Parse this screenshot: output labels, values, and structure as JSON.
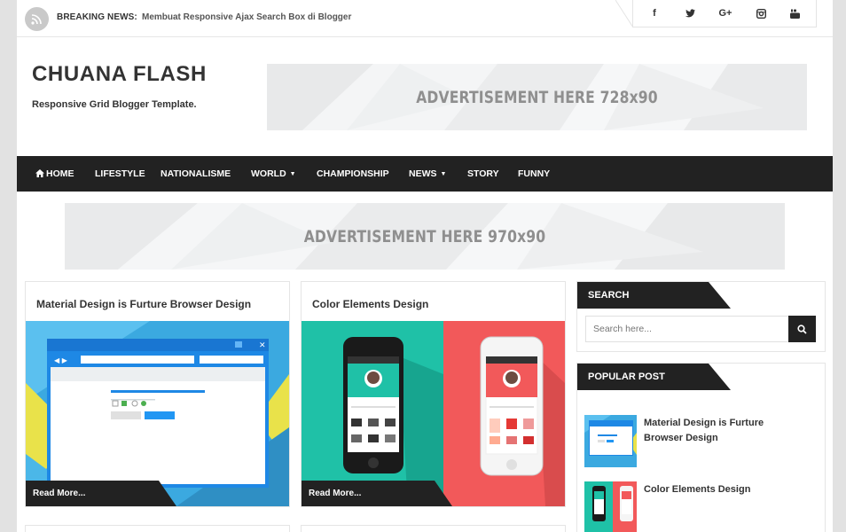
{
  "topbar": {
    "breaking_label": "BREAKING NEWS:",
    "breaking_text": "Membuat Responsive Ajax Search Box di Blogger",
    "rss_icon": "rss-icon",
    "social_icons": [
      "facebook-icon",
      "twitter-icon",
      "google-plus-icon",
      "instagram-icon",
      "youtube-icon"
    ]
  },
  "header": {
    "title": "CHUANA FLASH",
    "tagline": "Responsive Grid Blogger Template.",
    "ad_top": "ADVERTISEMENT HERE 728x90"
  },
  "nav": {
    "items": [
      {
        "label": "HOME",
        "icon": "home-icon"
      },
      {
        "label": "LIFESTYLE"
      },
      {
        "label": "NATIONALISME"
      },
      {
        "label": "WORLD",
        "dropdown": true
      },
      {
        "label": "CHAMPIONSHIP"
      },
      {
        "label": "NEWS",
        "dropdown": true
      },
      {
        "label": "STORY"
      },
      {
        "label": "FUNNY"
      }
    ]
  },
  "banner": {
    "ad_text": "ADVERTISEMENT HERE 970x90"
  },
  "posts": [
    {
      "title": "Material Design is Furture Browser Design",
      "read_more": "Read More..."
    },
    {
      "title": "Color Elements Design",
      "read_more": "Read More..."
    }
  ],
  "sidebar": {
    "search": {
      "title": "SEARCH",
      "placeholder": "Search here..."
    },
    "popular": {
      "title": "POPULAR POST",
      "items": [
        {
          "title": "Material Design is Furture Browser Design"
        },
        {
          "title": "Color Elements Design"
        }
      ]
    }
  },
  "colors": {
    "dark": "#222222",
    "accent_teal": "#1fc1a7",
    "accent_red": "#f2595a",
    "accent_blue": "#2196f3"
  }
}
